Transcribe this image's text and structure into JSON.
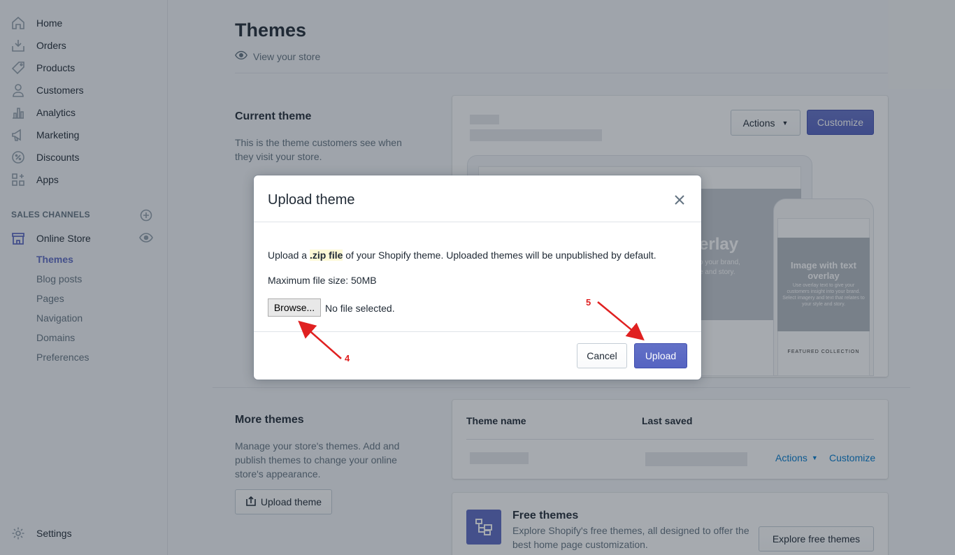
{
  "sidebar": {
    "nav": [
      {
        "label": "Home",
        "icon": "home-icon"
      },
      {
        "label": "Orders",
        "icon": "orders-icon"
      },
      {
        "label": "Products",
        "icon": "tag-icon"
      },
      {
        "label": "Customers",
        "icon": "person-icon"
      },
      {
        "label": "Analytics",
        "icon": "bar-chart-icon"
      },
      {
        "label": "Marketing",
        "icon": "megaphone-icon"
      },
      {
        "label": "Discounts",
        "icon": "discount-icon"
      },
      {
        "label": "Apps",
        "icon": "apps-icon"
      }
    ],
    "sales_channels_title": "SALES CHANNELS",
    "online_store": "Online Store",
    "subnav": [
      "Themes",
      "Blog posts",
      "Pages",
      "Navigation",
      "Domains",
      "Preferences"
    ],
    "settings": "Settings"
  },
  "page": {
    "title": "Themes",
    "view_store": "View your store"
  },
  "current_theme": {
    "heading": "Current theme",
    "description": "This is the theme customers see when they visit your store.",
    "actions_label": "Actions",
    "customize_label": "Customize",
    "preview": {
      "hero_title": "erlay",
      "hero_line1": "o your brand,",
      "hero_line2": "e and story.",
      "phone_hero_title": "Image with text overlay",
      "phone_hero_text": "Use overlay text to give your customers insight into your brand. Select imagery and text that relates to your style and story.",
      "featured": "FEATURED COLLECTION"
    }
  },
  "more_themes": {
    "heading": "More themes",
    "description": "Manage your store's themes. Add and publish themes to change your online store's appearance.",
    "upload_label": "Upload theme",
    "col_name": "Theme name",
    "col_saved": "Last saved",
    "actions_label": "Actions",
    "customize_label": "Customize"
  },
  "free_themes": {
    "title": "Free themes",
    "description": "Explore Shopify's free themes, all designed to offer the best home page customization.",
    "button": "Explore free themes"
  },
  "modal": {
    "title": "Upload theme",
    "line1_pre": "Upload a ",
    "line1_hl": ".zip file",
    "line1_post": " of your Shopify theme. Uploaded themes will be unpublished by default.",
    "max_size": "Maximum file size: 50MB",
    "browse": "Browse...",
    "no_file": "No file selected.",
    "cancel": "Cancel",
    "upload": "Upload"
  },
  "annotations": {
    "arrow_browse": "4",
    "arrow_upload": "5"
  },
  "colors": {
    "primary": "#5c6ac4",
    "link": "#007ace",
    "annotation": "#e02020"
  }
}
